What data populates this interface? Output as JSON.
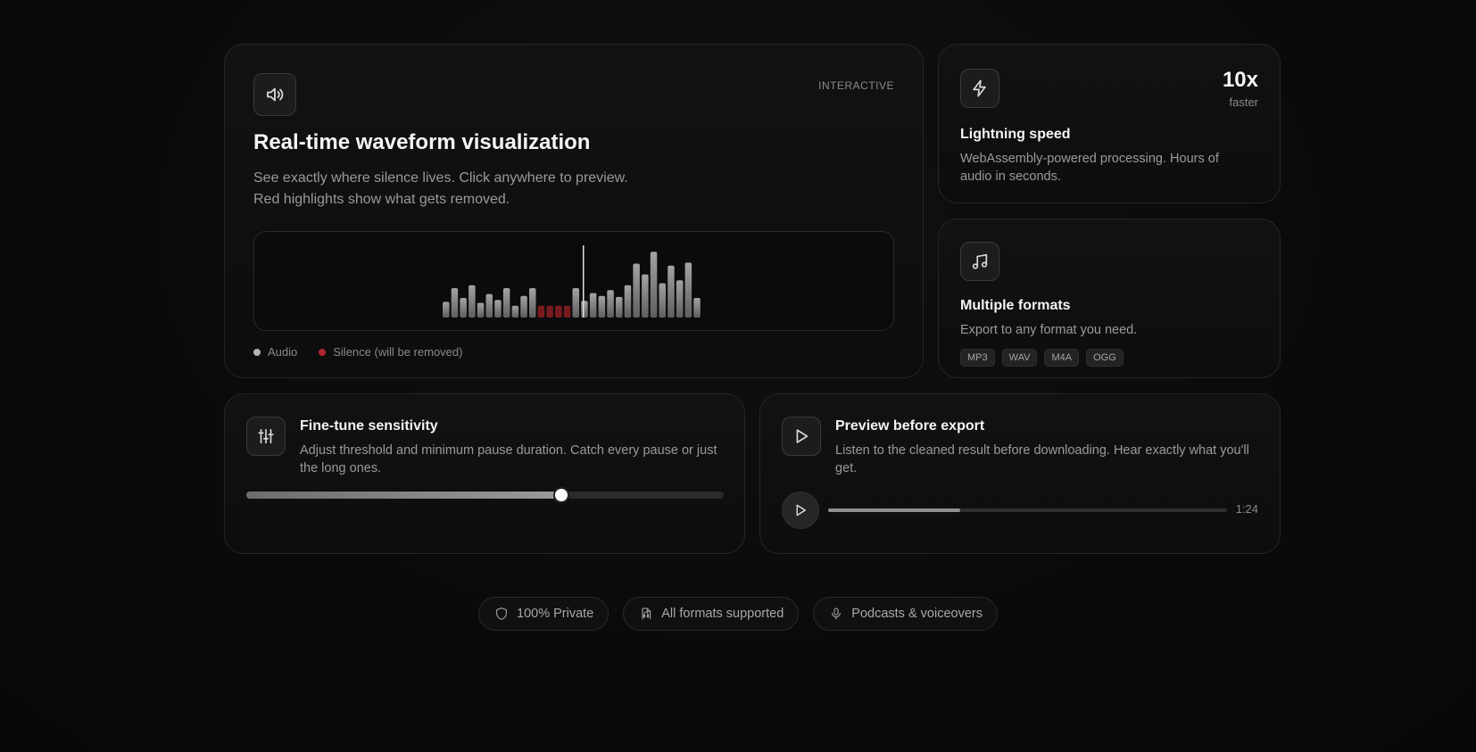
{
  "waveform_card": {
    "tag": "INTERACTIVE",
    "icon": "speaker-icon",
    "title": "Real-time waveform visualization",
    "description": "See exactly where silence lives. Click anywhere to preview. Red highlights show what gets removed.",
    "legend": {
      "audio": "Audio",
      "silence": "Silence (will be removed)"
    },
    "bars": [
      {
        "level": 0.16,
        "silence": false
      },
      {
        "level": 0.3,
        "silence": false
      },
      {
        "level": 0.2,
        "silence": false
      },
      {
        "level": 0.33,
        "silence": false
      },
      {
        "level": 0.15,
        "silence": false
      },
      {
        "level": 0.24,
        "silence": false
      },
      {
        "level": 0.18,
        "silence": false
      },
      {
        "level": 0.3,
        "silence": false
      },
      {
        "level": 0.12,
        "silence": false
      },
      {
        "level": 0.22,
        "silence": false
      },
      {
        "level": 0.3,
        "silence": false
      },
      {
        "level": 0.12,
        "silence": true
      },
      {
        "level": 0.12,
        "silence": true
      },
      {
        "level": 0.12,
        "silence": true
      },
      {
        "level": 0.12,
        "silence": true
      },
      {
        "level": 0.3,
        "silence": false
      },
      {
        "level": 0.17,
        "silence": false
      },
      {
        "level": 0.25,
        "silence": false
      },
      {
        "level": 0.22,
        "silence": false
      },
      {
        "level": 0.28,
        "silence": false
      },
      {
        "level": 0.21,
        "silence": false
      },
      {
        "level": 0.33,
        "silence": false
      },
      {
        "level": 0.55,
        "silence": false
      },
      {
        "level": 0.44,
        "silence": false
      },
      {
        "level": 0.67,
        "silence": false
      },
      {
        "level": 0.35,
        "silence": false
      },
      {
        "level": 0.53,
        "silence": false
      },
      {
        "level": 0.38,
        "silence": false
      },
      {
        "level": 0.56,
        "silence": false
      },
      {
        "level": 0.2,
        "silence": false
      }
    ],
    "playhead_position": 0.515,
    "colors": {
      "audio": "#8c8c8c",
      "silence": "#7a1a1f",
      "legend_audio": "#b5b5b5",
      "legend_silence": "#b3262e",
      "playhead": "#e0e0e0"
    }
  },
  "speed_card": {
    "icon": "lightning-icon",
    "stat": "10x",
    "stat_label": "faster",
    "title": "Lightning speed",
    "description": "WebAssembly-powered processing. Hours of audio in seconds."
  },
  "formats_card": {
    "icon": "music-note-icon",
    "title": "Multiple formats",
    "description": "Export to any format you need.",
    "formats": [
      "MP3",
      "WAV",
      "M4A",
      "OGG"
    ]
  },
  "sensitivity_card": {
    "icon": "sliders-icon",
    "title": "Fine-tune sensitivity",
    "description": "Adjust threshold and minimum pause duration. Catch every pause or just the long ones.",
    "slider_value": 0.66
  },
  "preview_card": {
    "icon": "play-icon",
    "title": "Preview before export",
    "description": "Listen to the cleaned result before downloading. Hear exactly what you'll get.",
    "progress": 0.33,
    "duration": "1:24"
  },
  "pills": [
    {
      "icon": "shield-icon",
      "label": "100% Private"
    },
    {
      "icon": "file-audio-icon",
      "label": "All formats supported"
    },
    {
      "icon": "microphone-icon",
      "label": "Podcasts & voiceovers"
    }
  ]
}
